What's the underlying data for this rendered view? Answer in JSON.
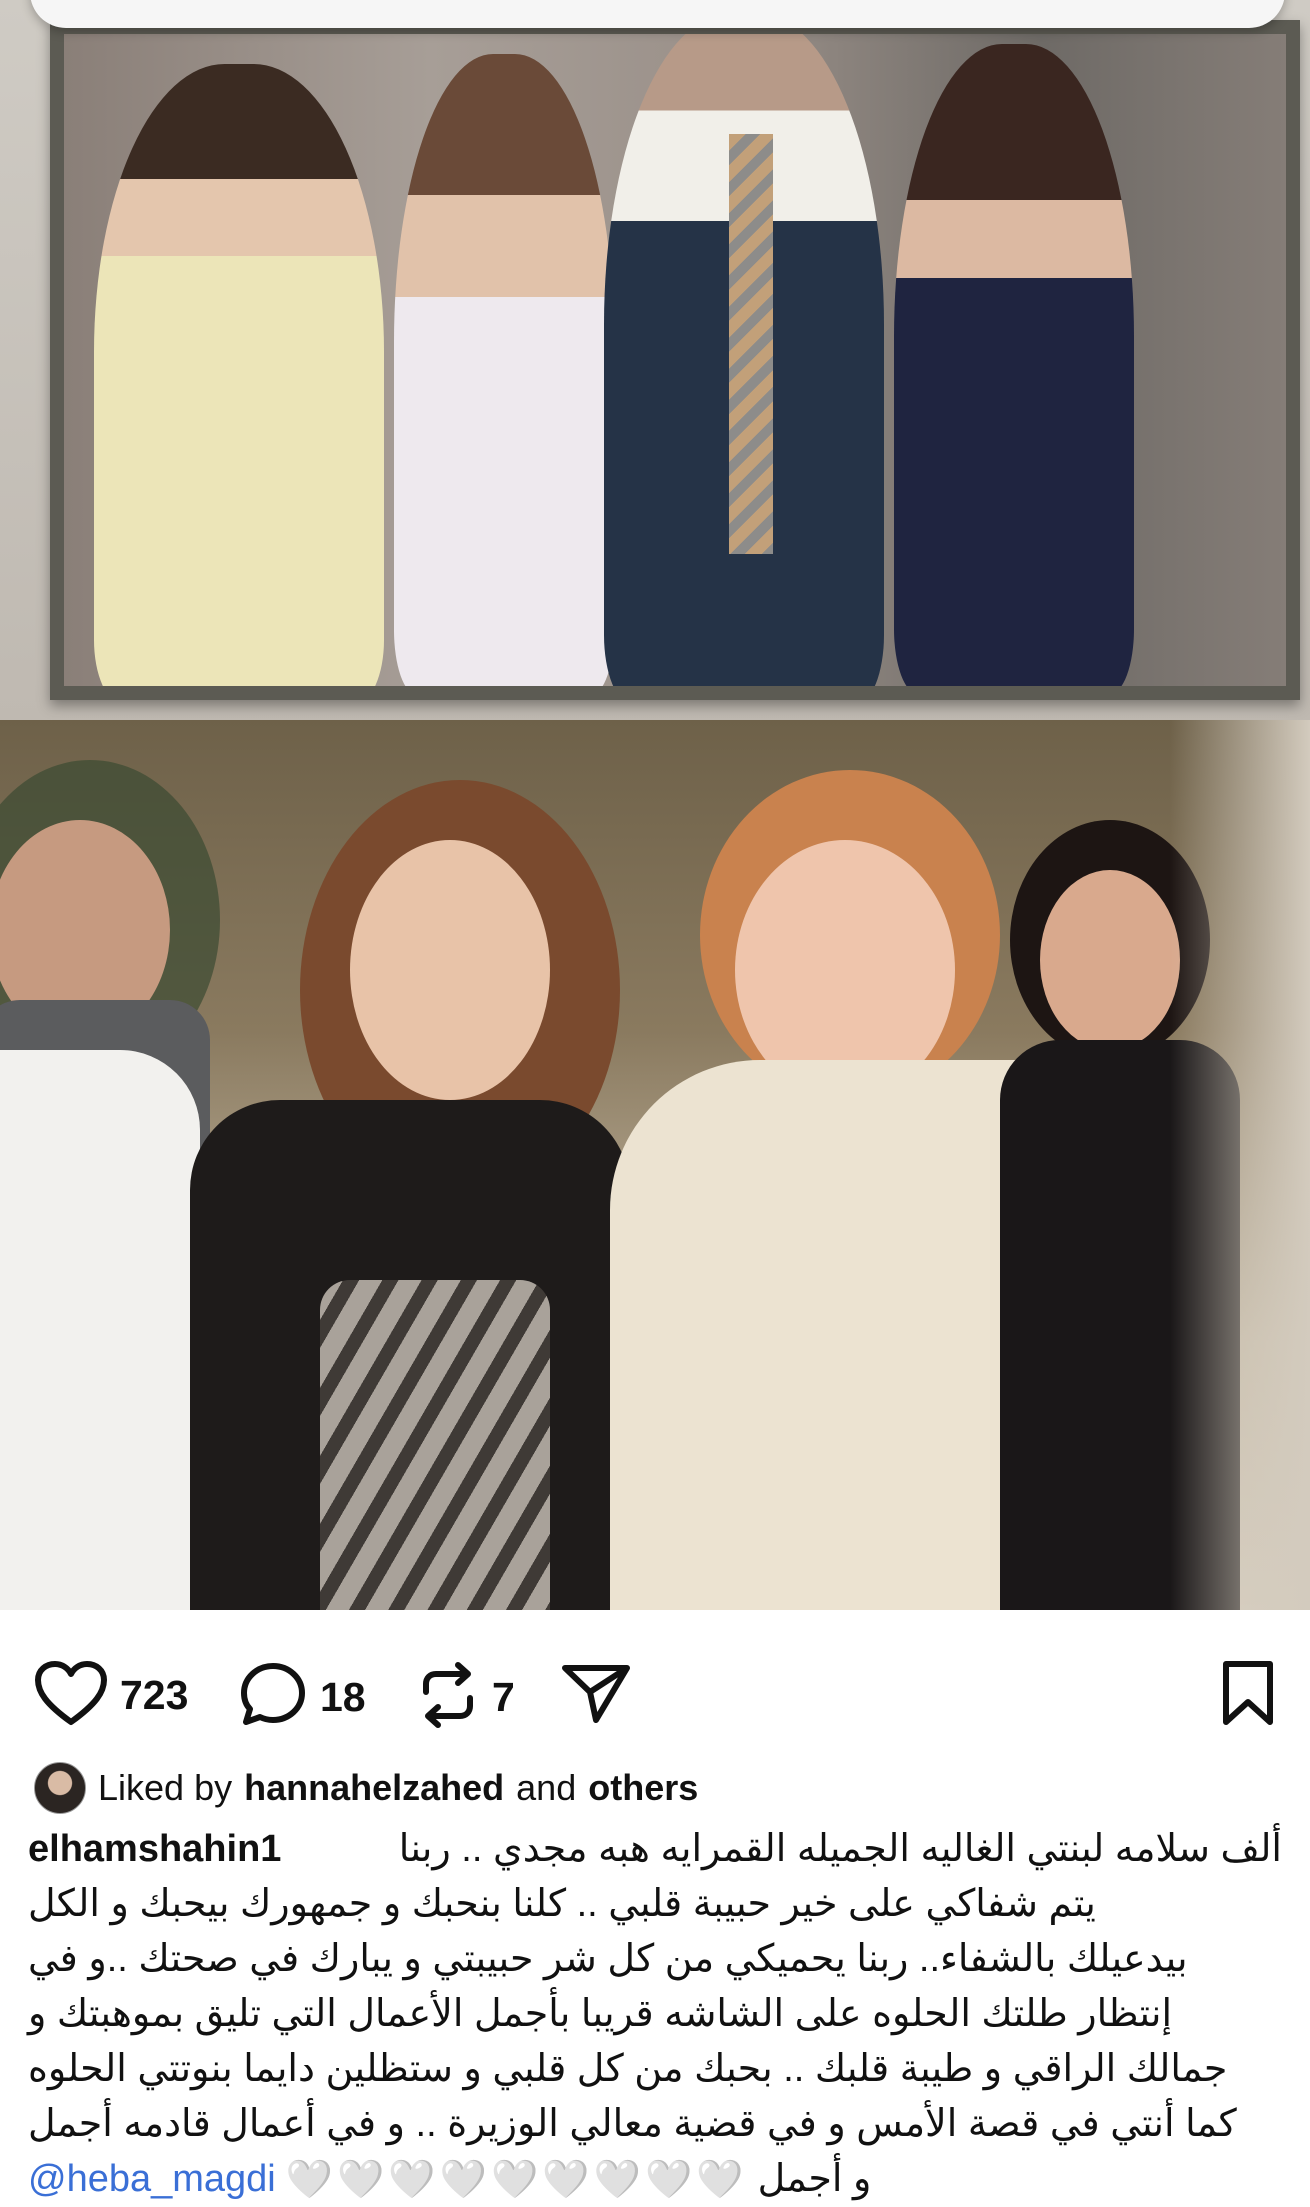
{
  "post": {
    "likes_count": "723",
    "comments_count": "18",
    "reposts_count": "7"
  },
  "liked_by": {
    "prefix": "Liked by",
    "user": "hannahelzahed",
    "joiner": "and",
    "others": "others"
  },
  "caption": {
    "username": "elhamshahin1",
    "lines": [
      "ألف سلامه لبنتي الغاليه الجميله القمرايه هبه مجدي .. ربنا",
      "يتم شفاكي على خير حبيبة قلبي .. كلنا بنحبك و جمهورك بيحبك و الكل",
      "بيدعيلك بالشفاء.. ربنا يحميكي من كل شر حبيبتي و يبارك في صحتك ..و في",
      "إنتظار طلتك الحلوه على الشاشه قريبا بأجمل الأعمال  التي تليق بموهبتك و",
      "جمالك الراقي و طيبة قلبك .. بحبك من كل قلبي و ستظلين دايما بنوتتي الحلوه",
      "كما أنتي في قصة الأمس و في قضية معالي الوزيرة .. و في أعمال قادمه أجمل",
      "و أجمل"
    ],
    "hearts": "🤍🤍🤍🤍🤍🤍🤍🤍🤍",
    "mention": "@heba_magdi"
  },
  "icons": {
    "like": "heart-icon",
    "comment": "comment-icon",
    "repost": "repost-icon",
    "share": "send-icon",
    "save": "bookmark-icon"
  }
}
